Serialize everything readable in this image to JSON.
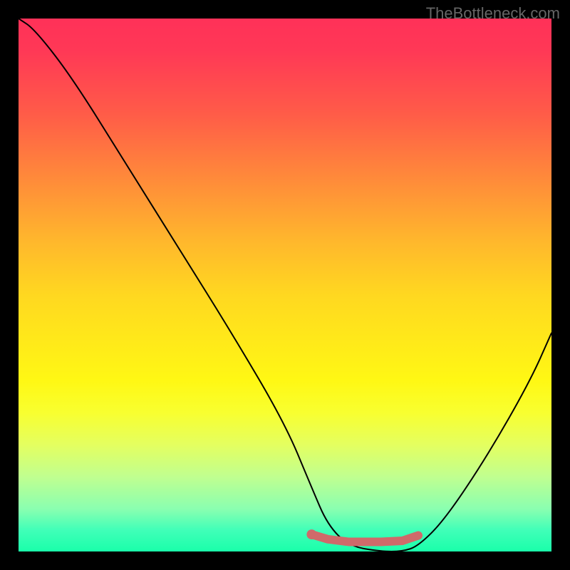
{
  "watermark": "TheBottleneck.com",
  "chart_data": {
    "type": "line",
    "title": "",
    "xlabel": "",
    "ylabel": "",
    "xlim": [
      0,
      100
    ],
    "ylim": [
      0,
      100
    ],
    "grid": false,
    "legend": false,
    "series": [
      {
        "name": "curve",
        "x": [
          0,
          3,
          10,
          20,
          30,
          40,
          50,
          55,
          58,
          62,
          68,
          72,
          75,
          80,
          88,
          96,
          100
        ],
        "y": [
          100,
          98,
          89,
          73,
          57,
          41,
          24,
          12,
          5,
          1,
          0,
          0,
          1,
          6,
          18,
          32,
          41
        ],
        "color": "#000000"
      },
      {
        "name": "highlight",
        "x": [
          55,
          58,
          62,
          68,
          72,
          75
        ],
        "y": [
          3.2,
          2.3,
          1.8,
          1.8,
          2.0,
          3.0
        ],
        "color": "#cf6a6a"
      }
    ],
    "points": [
      {
        "name": "marker",
        "x": 55,
        "y": 3.2,
        "color": "#cf6a6a"
      }
    ],
    "background_gradient": {
      "direction": "vertical",
      "stops": [
        {
          "pos": 0,
          "color": "#ff3158"
        },
        {
          "pos": 50,
          "color": "#ffd820"
        },
        {
          "pos": 100,
          "color": "#1affaa"
        }
      ]
    }
  }
}
